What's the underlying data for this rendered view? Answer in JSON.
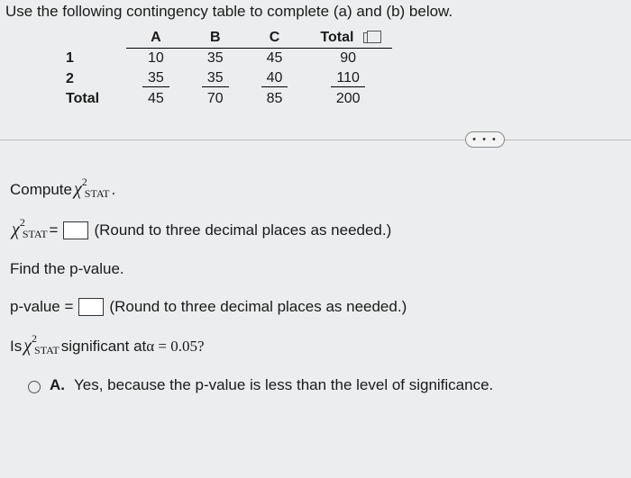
{
  "intro": "Use the following contingency table to complete (a) and (b) below.",
  "table": {
    "cols": [
      "A",
      "B",
      "C",
      "Total"
    ],
    "rows": [
      {
        "label": "1",
        "cells": [
          "10",
          "35",
          "45",
          "90"
        ]
      },
      {
        "label": "2",
        "cells": [
          "35",
          "35",
          "40",
          "110"
        ]
      },
      {
        "label": "Total",
        "cells": [
          "45",
          "70",
          "85",
          "200"
        ]
      }
    ]
  },
  "compute_prefix": "Compute ",
  "chi_label": "χ",
  "chi_sup": "2",
  "chi_sub": "STAT",
  "compute_period": ".",
  "eq": " = ",
  "round_hint": "(Round to three decimal places as needed.)",
  "find_pvalue": "Find the p-value.",
  "pvalue_label": "p-value =",
  "sig_prefix": "Is ",
  "sig_suffix": " significant at ",
  "alpha_expr": "α = 0.05?",
  "option": {
    "letter": "A.",
    "text": "Yes, because the p-value is less than the level of significance."
  },
  "ellipsis": "• • •"
}
